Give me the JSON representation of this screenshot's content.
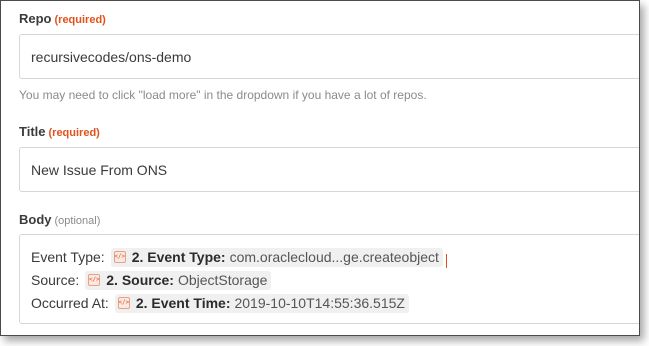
{
  "repo": {
    "label": "Repo",
    "required": "(required)",
    "value": "recursivecodes/ons-demo",
    "help": "You may need to click \"load more\" in the dropdown if you have a lot of repos."
  },
  "title": {
    "label": "Title",
    "required": "(required)",
    "value": "New Issue From ONS"
  },
  "body": {
    "label": "Body",
    "optional": "(optional)",
    "lines": [
      {
        "prefix": "Event Type:",
        "pill_key": "2. Event Type:",
        "pill_value": "com.oraclecloud...ge.createobject"
      },
      {
        "prefix": "Source:",
        "pill_key": "2. Source:",
        "pill_value": "ObjectStorage"
      },
      {
        "prefix": "Occurred At:",
        "pill_key": "2. Event Time:",
        "pill_value": "2019-10-10T14:55:36.515Z"
      }
    ],
    "pill_icon": "code-tag-icon",
    "pill_icon_glyph": "</>"
  },
  "colors": {
    "required": "#e0521c",
    "border": "#d6d6d6",
    "text": "#3a3a3a"
  }
}
